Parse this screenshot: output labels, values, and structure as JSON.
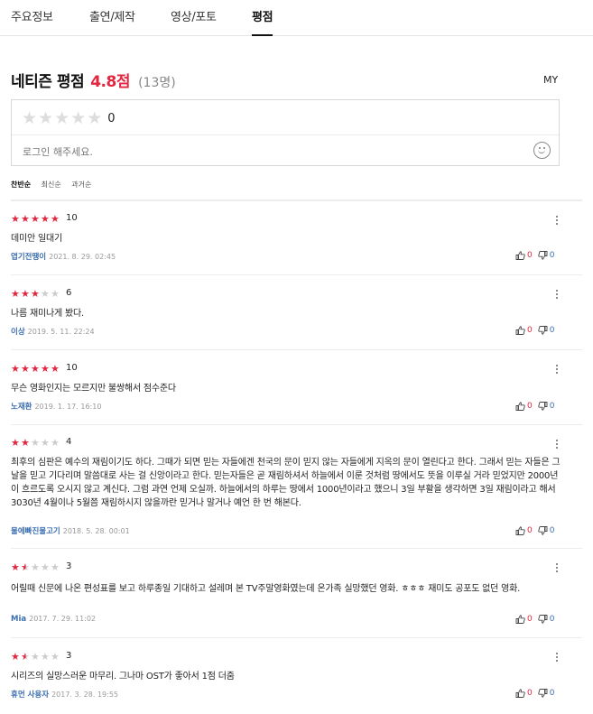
{
  "tabs": [
    "주요정보",
    "출연/제작",
    "영상/포토",
    "평점"
  ],
  "header": {
    "title": "네티즌 평점",
    "score": "4.8점",
    "count": "(13명)",
    "my": "MY"
  },
  "input": {
    "score": "0",
    "placeholder": "로그인 해주세요."
  },
  "sort": [
    "찬반순",
    "최신순",
    "과거순"
  ],
  "colors": {
    "accent": "#e32640",
    "author": "#3b6eb0"
  },
  "reviews": [
    {
      "score": "10",
      "stars": 5,
      "text": "데미안 일대기",
      "author": "엽기전땡이",
      "date": "2021. 8. 29. 02:45",
      "likes": "0",
      "dislikes": "0"
    },
    {
      "score": "6",
      "stars": 3,
      "text": "나름 재미나게 봤다.",
      "author": "이상",
      "date": "2019. 5. 11. 22:24",
      "likes": "0",
      "dislikes": "0"
    },
    {
      "score": "10",
      "stars": 5,
      "text": "무슨 영화인지는 모르지만 불쌍해서 점수준다",
      "author": "노재환",
      "date": "2019. 1. 17. 16:10",
      "likes": "0",
      "dislikes": "0"
    },
    {
      "score": "4",
      "stars": 2,
      "text": "최후의 심판은 예수의 재림이기도 하다. 그때가 되면 믿는 자들에겐 천국의 문이 믿지 않는 자들에게 지옥의 문이 열린다고 한다. 그래서 믿는 자들은 그날을 믿고 기다리며 말씀대로 사는 걸 신앙이라고 한다. 믿는자들은 곧 재림하셔서 하늘에서 이룬 것처럼 땅에서도 뜻을 이루실 거라 믿었지만 2000년이 흐르도록 오시지 않고 계신다. 그럼 과연 언제 오실까. 하늘에서의 하루는 땅에서 1000년이라고 했으니 3일 부활을 생각하면 3일 재림이라고 해서 3030년 4월이나 5월쯤 재림하시지 않을까란 믿거나 말거나 예언 한 번 해본다.",
      "author": "물에빠진물고기",
      "date": "2018. 5. 28. 00:01",
      "likes": "0",
      "dislikes": "0"
    },
    {
      "score": "3",
      "stars": 1.5,
      "text": "어릴때 신문에 나온 편성표를 보고 하루종일 기대하고 설레며 본 TV주말영화였는데 온가족 실망했던 영화. ㅎㅎㅎ 재미도 공포도 없던 영화.",
      "author": "Mia",
      "date": "2017. 7. 29. 11:02",
      "likes": "0",
      "dislikes": "0"
    },
    {
      "score": "3",
      "stars": 1.5,
      "text": "시리즈의 실망스러운 마무리. 그나마 OST가 좋아서 1점 더줌",
      "author": "휴먼 사용자",
      "date": "2017. 3. 28. 19:55",
      "likes": "0",
      "dislikes": "0"
    }
  ]
}
